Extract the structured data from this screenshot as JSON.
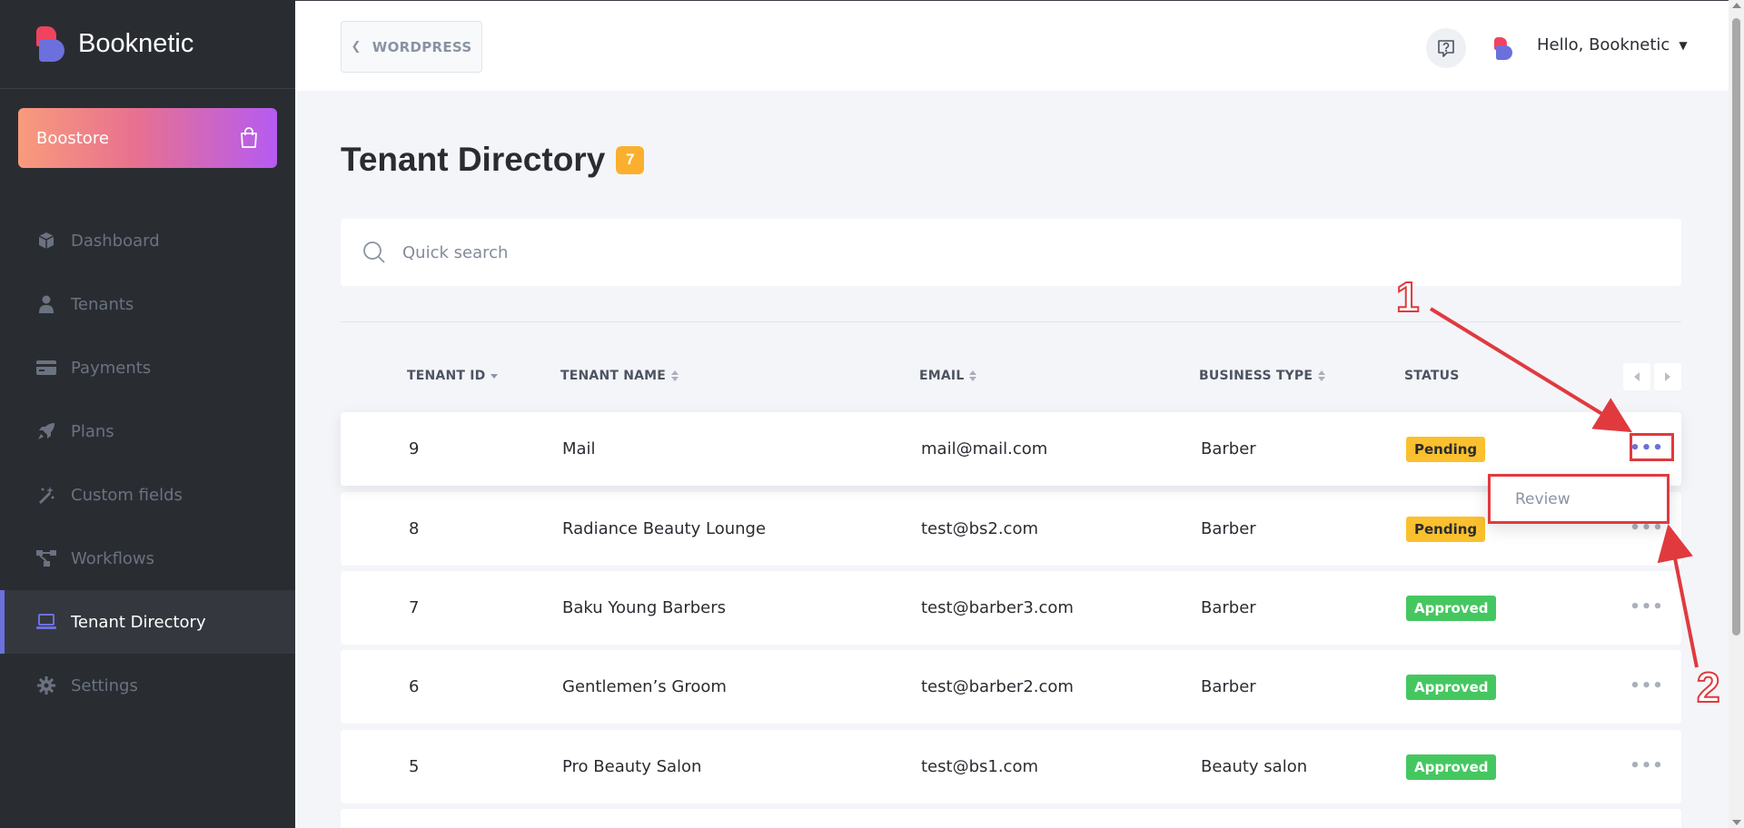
{
  "brand": {
    "name": "Booknetic"
  },
  "boostore": {
    "label": "Boostore"
  },
  "sidebar": {
    "items": [
      {
        "label": "Dashboard",
        "icon": "cube-icon",
        "active": false
      },
      {
        "label": "Tenants",
        "icon": "user-tie-icon",
        "active": false
      },
      {
        "label": "Payments",
        "icon": "credit-card-icon",
        "active": false
      },
      {
        "label": "Plans",
        "icon": "rocket-icon",
        "active": false
      },
      {
        "label": "Custom fields",
        "icon": "magic-wand-icon",
        "active": false
      },
      {
        "label": "Workflows",
        "icon": "workflow-icon",
        "active": false
      },
      {
        "label": "Tenant Directory",
        "icon": "laptop-icon",
        "active": true
      },
      {
        "label": "Settings",
        "icon": "gear-icon",
        "active": false
      }
    ]
  },
  "topbar": {
    "back_label": "WORDPRESS",
    "greeting": "Hello, Booknetic"
  },
  "page": {
    "title": "Tenant Directory",
    "count": "7"
  },
  "search": {
    "placeholder": "Quick search"
  },
  "table": {
    "columns": [
      "TENANT ID",
      "TENANT NAME",
      "EMAIL",
      "BUSINESS TYPE",
      "STATUS"
    ],
    "rows": [
      {
        "id": "9",
        "name": "Mail",
        "email": "mail@mail.com",
        "type": "Barber",
        "status": "Pending"
      },
      {
        "id": "8",
        "name": "Radiance Beauty Lounge",
        "email": "test@bs2.com",
        "type": "Barber",
        "status": "Pending"
      },
      {
        "id": "7",
        "name": "Baku Young Barbers",
        "email": "test@barber3.com",
        "type": "Barber",
        "status": "Approved"
      },
      {
        "id": "6",
        "name": "Gentlemen’s Groom",
        "email": "test@barber2.com",
        "type": "Barber",
        "status": "Approved"
      },
      {
        "id": "5",
        "name": "Pro Beauty Salon",
        "email": "test@bs1.com",
        "type": "Beauty salon",
        "status": "Approved"
      }
    ]
  },
  "dropdown": {
    "review_label": "Review"
  },
  "annotations": {
    "step1": "1",
    "step2": "2"
  },
  "colors": {
    "sidebar_bg": "#292d32",
    "accent": "#6c70dc",
    "pending": "#fbc02d",
    "approved": "#45c760",
    "badge": "#fbaf2e",
    "annotation": "#e03a3f"
  }
}
